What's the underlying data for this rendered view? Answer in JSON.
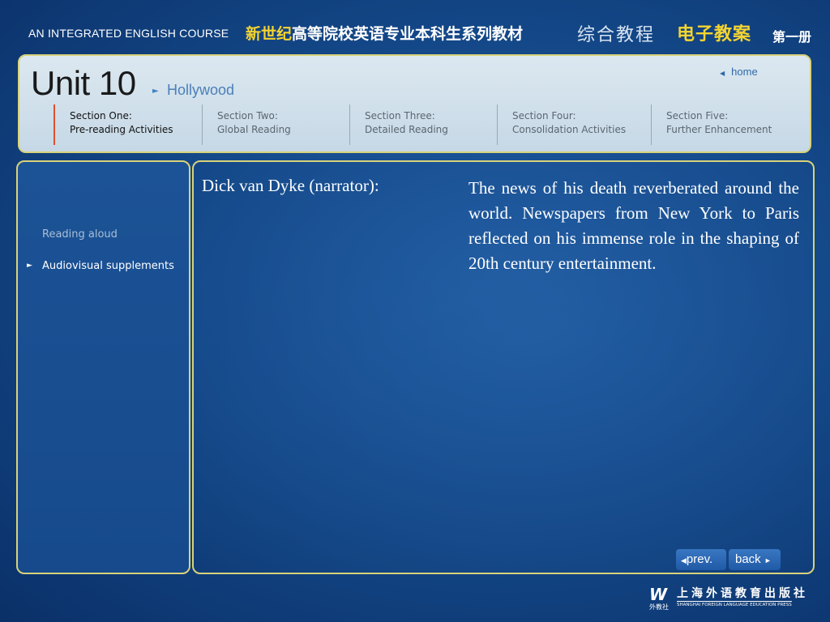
{
  "topbar": {
    "course_title": "AN INTEGRATED ENGLISH COURSE",
    "series_highlight": "新世纪",
    "series_rest": "高等院校英语专业本科生系列教材",
    "comprehensive": "综合教程",
    "electronic": "电子教案",
    "volume": "第一册"
  },
  "header": {
    "unit": "Unit 10",
    "subtitle": "Hollywood",
    "home": "home",
    "sections": [
      {
        "line1": "Section One:",
        "line2": "Pre-reading Activities"
      },
      {
        "line1": "Section Two:",
        "line2": "Global Reading"
      },
      {
        "line1": "Section Three:",
        "line2": "Detailed Reading"
      },
      {
        "line1": "Section Four:",
        "line2": "Consolidation Activities"
      },
      {
        "line1": "Section Five:",
        "line2": "Further Enhancement"
      }
    ]
  },
  "sidebar": {
    "items": [
      {
        "label": "Reading aloud"
      },
      {
        "label": "Audiovisual supplements"
      }
    ]
  },
  "main": {
    "speaker": "Dick van Dyke (narrator):",
    "passage": "The news of his death reverberated around the world. Newspapers from New York to Paris reflected on his immense role in the shaping of 20th century entertainment."
  },
  "nav": {
    "prev": "prev.",
    "back": "back"
  },
  "publisher": {
    "logo": "W",
    "logo_sub": "外教社",
    "name_cn": "上海外语教育出版社",
    "name_en": "SHANGHAI FOREIGN LANGUAGE EDUCATION PRESS"
  }
}
